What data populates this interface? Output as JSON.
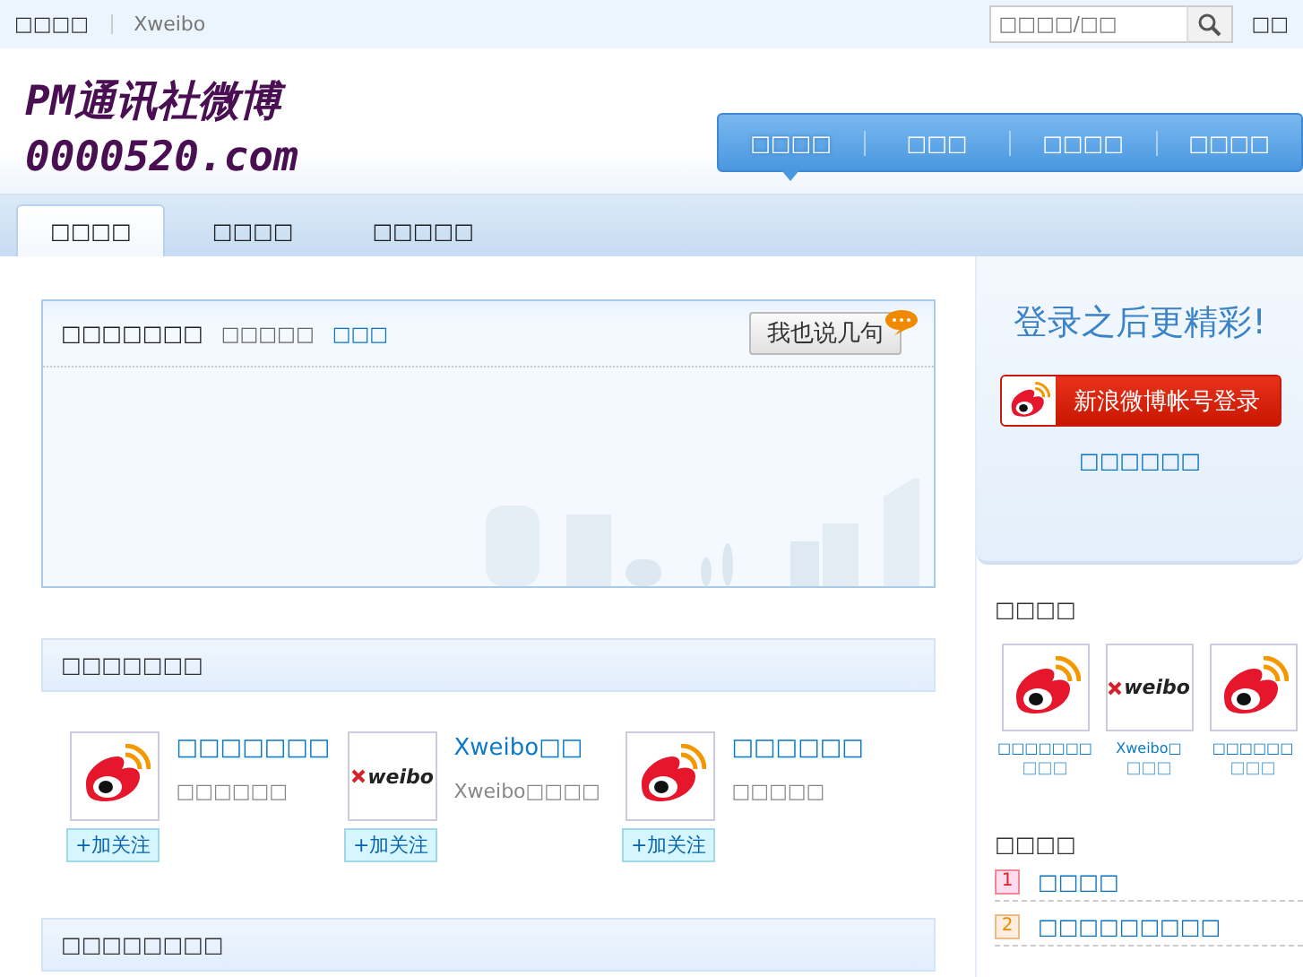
{
  "top_bar": {
    "links": [
      "□□□□",
      "Xweibo"
    ],
    "search": {
      "placeholder": "□□□□/□□"
    },
    "right_link": "□□"
  },
  "logo": {
    "line_1": "PM通讯社微博",
    "line_2": "0000520.com"
  },
  "nav": [
    {
      "label": "□□□□",
      "selected": true
    },
    {
      "label": "□□□",
      "selected": false
    },
    {
      "label": "□□□□",
      "selected": false
    },
    {
      "label": "□□□□",
      "selected": false
    }
  ],
  "tabs": [
    {
      "label": "□□□□",
      "selected": true
    },
    {
      "label": "□□□□",
      "selected": false
    },
    {
      "label": "□□□□□",
      "selected": false
    }
  ],
  "topic_box": {
    "title": "□□□□□□□",
    "subtitle": "□□□□□",
    "link": "□□□",
    "button": "我也说几句"
  },
  "sections": [
    {
      "title": "□□□□□□□",
      "accounts": [
        {
          "name": "□□□□□□□",
          "description": "□□□□□□",
          "kind": "eye",
          "follow": "+加关注"
        },
        {
          "name": "Xweibo□□",
          "description": "Xweibo□□□□",
          "kind": "xweibo",
          "logo_text": "weibo",
          "follow": "+加关注"
        },
        {
          "name": "□□□□□□",
          "description": "□□□□□",
          "kind": "eye",
          "follow": "+加关注"
        }
      ]
    },
    {
      "title": "□□□□□□□□"
    }
  ],
  "sidebar": {
    "slogan": "登录之后更精彩!",
    "login_button": "新浪微博帐号登录",
    "register_link": "□□□□□□",
    "accounts_title": "□□□□",
    "accounts": [
      {
        "name": "□□□□□□□",
        "action": "□□□",
        "kind": "eye"
      },
      {
        "name": "Xweibo□",
        "action": "□□□",
        "kind": "xweibo",
        "logo_text": "weibo"
      },
      {
        "name": "□□□□□□",
        "action": "□□□",
        "kind": "eye"
      }
    ],
    "ranking_title": "□□□□",
    "ranking": [
      {
        "rank": "1",
        "label": "□□□□"
      },
      {
        "rank": "2",
        "label": "□□□□□□□□□"
      }
    ]
  }
}
